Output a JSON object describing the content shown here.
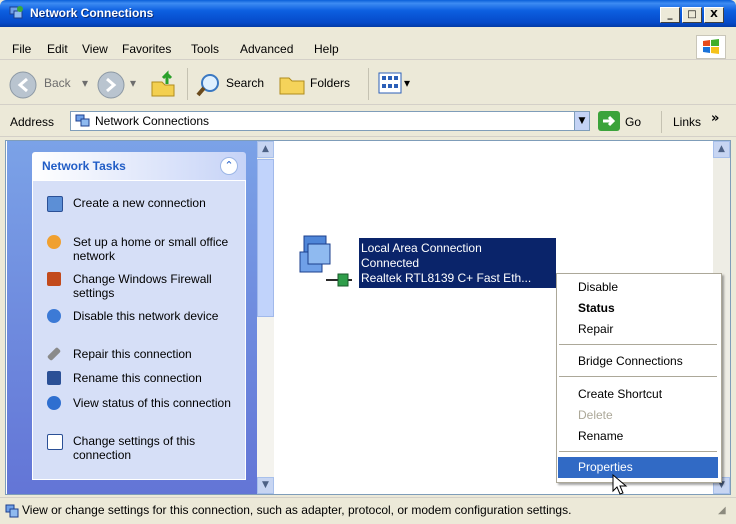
{
  "window": {
    "title": "Network Connections",
    "buttons": {
      "minimize": "_",
      "maximize": "□",
      "close": "X"
    }
  },
  "menubar": {
    "items": [
      "File",
      "Edit",
      "View",
      "Favorites",
      "Tools",
      "Advanced",
      "Help"
    ]
  },
  "toolbar": {
    "back_label": "Back",
    "search_label": "Search",
    "folders_label": "Folders"
  },
  "addressbar": {
    "label": "Address",
    "value": "Network Connections",
    "go_label": "Go",
    "links_label": "Links"
  },
  "tasks_panel": {
    "title": "Network Tasks",
    "items": [
      {
        "label": "Create a new connection",
        "icon": "new-connection-icon"
      },
      {
        "label": "Set up a home or small office network",
        "icon": "home-network-icon"
      },
      {
        "label": "Change Windows Firewall settings",
        "icon": "firewall-icon"
      },
      {
        "label": "Disable this network device",
        "icon": "disable-device-icon"
      },
      {
        "label": "Repair this connection",
        "icon": "repair-icon"
      },
      {
        "label": "Rename this connection",
        "icon": "rename-icon"
      },
      {
        "label": "View status of this connection",
        "icon": "status-icon"
      },
      {
        "label": "Change settings of this connection",
        "icon": "settings-icon"
      }
    ]
  },
  "connection": {
    "name": "Local Area Connection",
    "status": "Connected",
    "device": "Realtek RTL8139 C+ Fast Eth..."
  },
  "context_menu": {
    "items": [
      {
        "label": "Disable",
        "bold": false,
        "disabled": false
      },
      {
        "label": "Status",
        "bold": true,
        "disabled": false
      },
      {
        "label": "Repair",
        "bold": false,
        "disabled": false
      },
      {
        "label": "Bridge Connections",
        "bold": false,
        "disabled": false
      },
      {
        "label": "Create Shortcut",
        "bold": false,
        "disabled": false
      },
      {
        "label": "Delete",
        "bold": false,
        "disabled": true
      },
      {
        "label": "Rename",
        "bold": false,
        "disabled": false
      },
      {
        "label": "Properties",
        "bold": false,
        "disabled": false,
        "highlighted": true
      }
    ]
  },
  "statusbar": {
    "text": "View or change settings for this connection, such as adapter, protocol, or modem configuration settings."
  },
  "colors": {
    "selection": "#0a246a",
    "menu_highlight": "#316ac5",
    "taskpane_bg": "#d6dff7"
  }
}
